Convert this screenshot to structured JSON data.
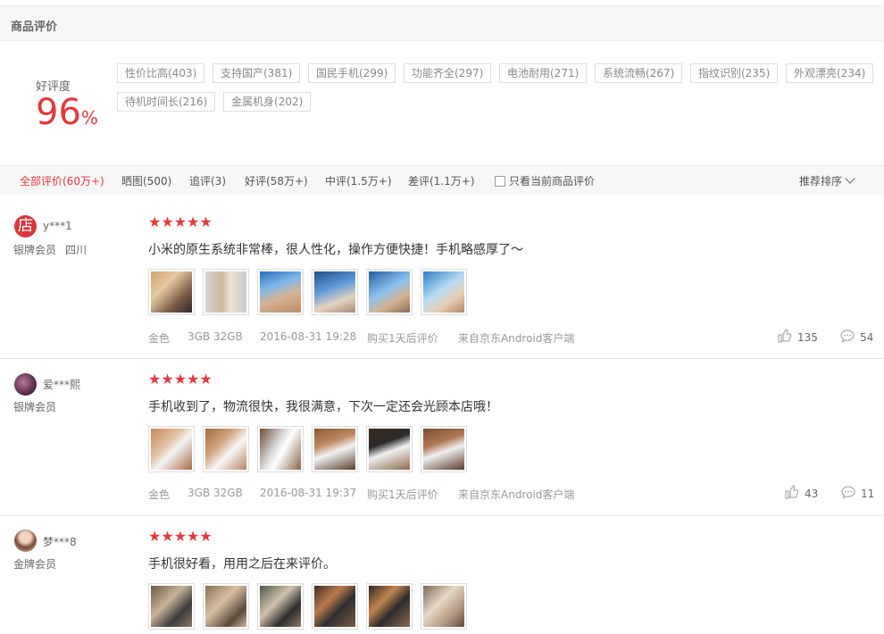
{
  "section": {
    "title": "商品评价"
  },
  "rating": {
    "label": "好评度",
    "value": "96",
    "unit": "%"
  },
  "tags": [
    "性价比高(403)",
    "支持国产(381)",
    "国民手机(299)",
    "功能齐全(297)",
    "电池耐用(271)",
    "系统流畅(267)",
    "指纹识别(235)",
    "外观漂亮(234)",
    "待机时间长(216)",
    "金属机身(202)"
  ],
  "filters": {
    "all": "全部评价(60万+)",
    "photos": "晒图(500)",
    "followup": "追评(3)",
    "good": "好评(58万+)",
    "medium": "中评(1.5万+)",
    "bad": "差评(1.1万+)",
    "current_only": "只看当前商品评价",
    "sort": "推荐排序"
  },
  "reviews": [
    {
      "username": "y***1",
      "level": "银牌会员",
      "location": "四川",
      "stars": "★★★★★",
      "text": "小米的原生系统非常棒，很人性化，操作方便快捷！手机略感厚了～",
      "color": "金色",
      "spec": "3GB 32GB",
      "date": "2016-08-31 19:28",
      "after": "购买1天后评价",
      "source": "来自京东Android客户端",
      "likes": "135",
      "comments": "54"
    },
    {
      "username": "爱***熙",
      "level": "银牌会员",
      "location": "",
      "stars": "★★★★★",
      "text": "手机收到了，物流很快，我很满意，下次一定还会光顾本店哦！",
      "color": "金色",
      "spec": "3GB 32GB",
      "date": "2016-08-31 19:37",
      "after": "购买1天后评价",
      "source": "来自京东Android客户端",
      "likes": "43",
      "comments": "11"
    },
    {
      "username": "梦***8",
      "level": "金牌会员",
      "location": "",
      "stars": "★★★★★",
      "text": "手机很好看，用用之后在来评价。"
    }
  ],
  "colors": {
    "accent": "#e4393c",
    "muted": "#999999"
  }
}
